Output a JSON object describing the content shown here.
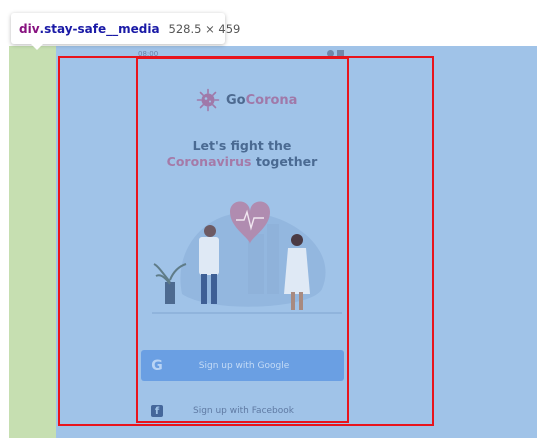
{
  "inspector": {
    "element_tag": "div",
    "element_class": ".stay-safe__media",
    "element_dims": "528.5 × 459"
  },
  "app": {
    "status_time": "08:00",
    "logo_prefix": "Go",
    "logo_suffix": "Corona",
    "headline_line1": "Let's fight the",
    "headline_accent": "Coronavirus",
    "headline_rest": " together",
    "google_button_label": "Sign up with Google",
    "google_icon_glyph": "G",
    "facebook_button_label": "Sign up with Facebook",
    "facebook_icon_glyph": "f"
  },
  "colors": {
    "content_overlay": "#a0c3e8",
    "padding_overlay": "#c6dfb1",
    "highlight_border": "#e8141c",
    "google_button": "#6a9fe3",
    "logo_accent": "#a079a9"
  }
}
